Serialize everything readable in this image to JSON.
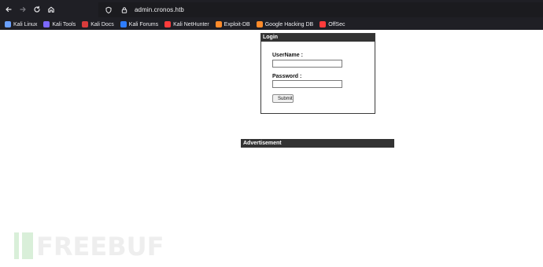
{
  "browser": {
    "url": "admin.cronos.htb",
    "bookmarks": [
      {
        "label": "Kali Linux",
        "icon": "kali-dragon-icon",
        "color": "#6aa0ff"
      },
      {
        "label": "Kali Tools",
        "icon": "kali-tools-icon",
        "color": "#7c69ff"
      },
      {
        "label": "Kali Docs",
        "icon": "kali-docs-icon",
        "color": "#d83b3b"
      },
      {
        "label": "Kali Forums",
        "icon": "kali-forums-icon",
        "color": "#2e7dff"
      },
      {
        "label": "Kali NetHunter",
        "icon": "kali-nethunter-icon",
        "color": "#ff3b3b"
      },
      {
        "label": "Exploit-DB",
        "icon": "exploit-db-icon",
        "color": "#ff8b2a"
      },
      {
        "label": "Google Hacking DB",
        "icon": "google-hacking-db-icon",
        "color": "#ff8b2a"
      },
      {
        "label": "OffSec",
        "icon": "offsec-icon",
        "color": "#ff3b3b"
      }
    ],
    "colors": {
      "chrome_bg": "#1f1f25",
      "panel_header_bg": "#333333"
    }
  },
  "login": {
    "header": "Login",
    "username_label": "UserName :",
    "username_value": "",
    "password_label": "Password :",
    "password_value": "",
    "submit_label": "Submit"
  },
  "advertisement": {
    "header": "Advertisement"
  },
  "watermark": {
    "text": "FREEBUF"
  }
}
